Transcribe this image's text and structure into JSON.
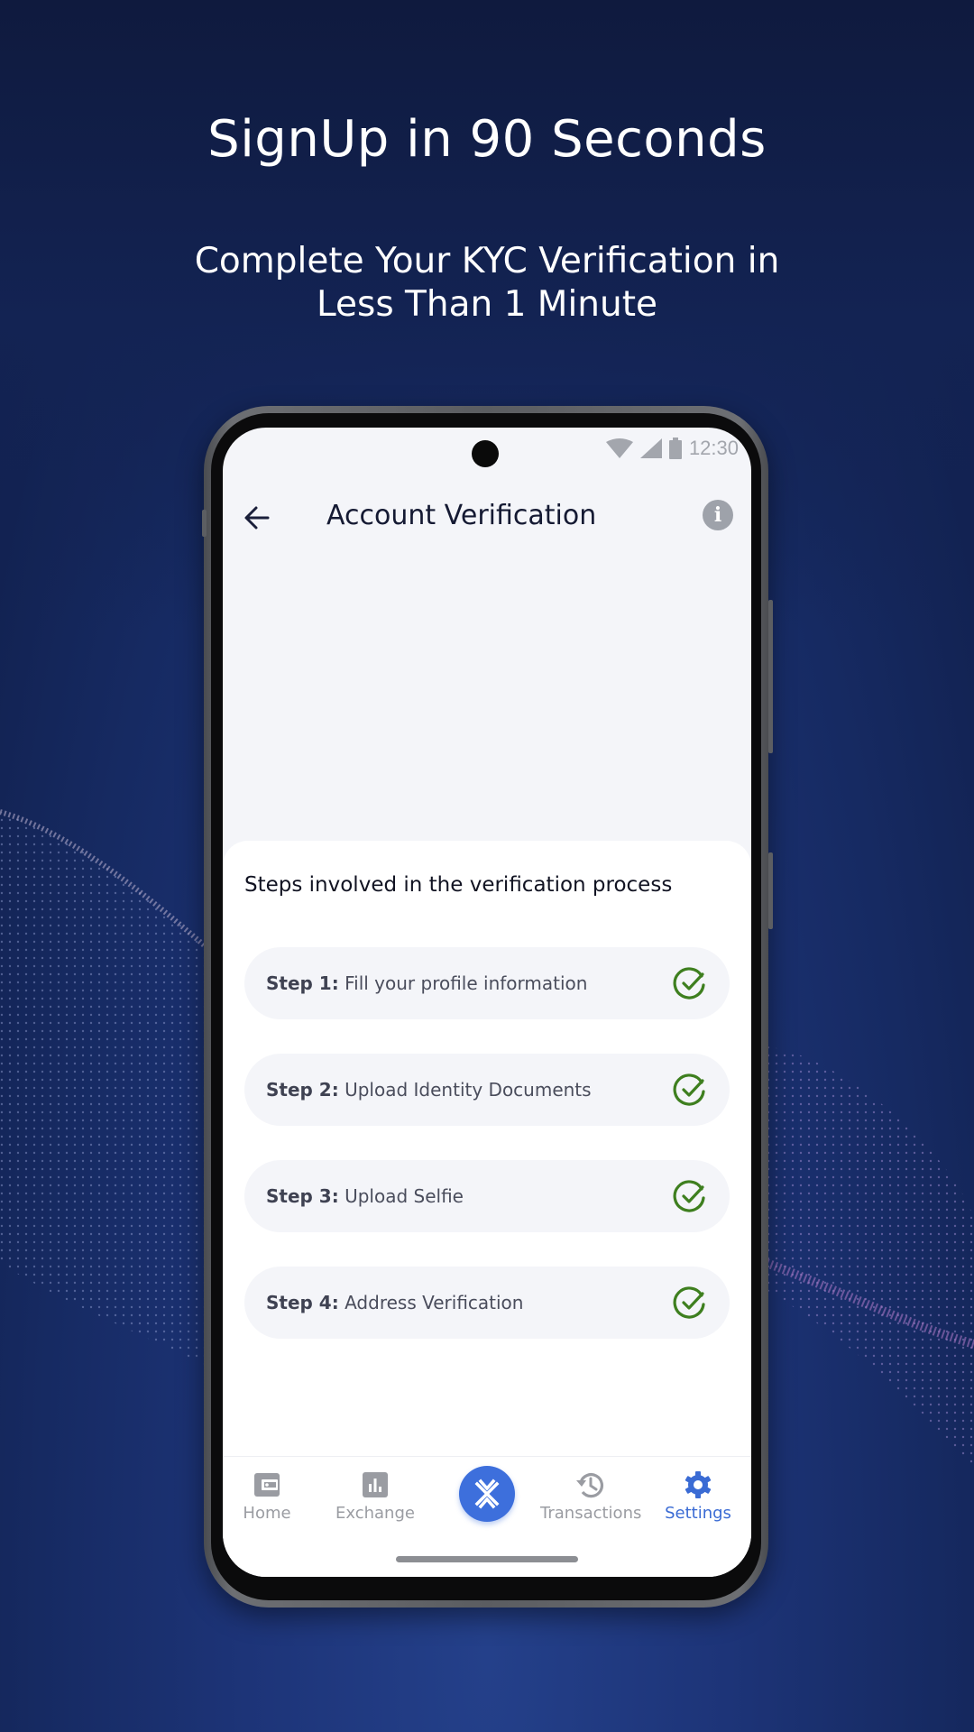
{
  "promo": {
    "headline": "SignUp in 90 Seconds",
    "subheadline_line1": "Complete Your KYC Verification in",
    "subheadline_line2": "Less Than 1 Minute"
  },
  "status_bar": {
    "time": "12:30",
    "icons": [
      "wifi-icon",
      "signal-icon",
      "battery-icon"
    ]
  },
  "app_bar": {
    "title": "Account Verification",
    "back_icon": "arrow-left-icon",
    "info_icon": "info-icon",
    "info_glyph": "i"
  },
  "steps_section": {
    "heading": "Steps involved in the verification process",
    "steps": [
      {
        "label": "Step 1:",
        "text": "Fill your profile information",
        "status": "completed"
      },
      {
        "label": "Step 2:",
        "text": "Upload Identity Documents",
        "status": "completed"
      },
      {
        "label": "Step 3:",
        "text": "Upload Selfie",
        "status": "completed"
      },
      {
        "label": "Step 4:",
        "text": "Address Verification",
        "status": "completed"
      }
    ]
  },
  "bottom_nav": {
    "items": [
      {
        "label": "Home",
        "icon": "wallet-icon",
        "active": false
      },
      {
        "label": "Exchange",
        "icon": "bar-chart-icon",
        "active": false
      },
      {
        "label": "",
        "icon": "app-logo-icon",
        "active": false
      },
      {
        "label": "Transactions",
        "icon": "history-icon",
        "active": false
      },
      {
        "label": "Settings",
        "icon": "gear-icon",
        "active": true
      }
    ]
  },
  "colors": {
    "accent": "#3d6fdc",
    "success": "#3e7f1f",
    "inactive": "#9a9ca2",
    "background_dark": "#132353"
  }
}
